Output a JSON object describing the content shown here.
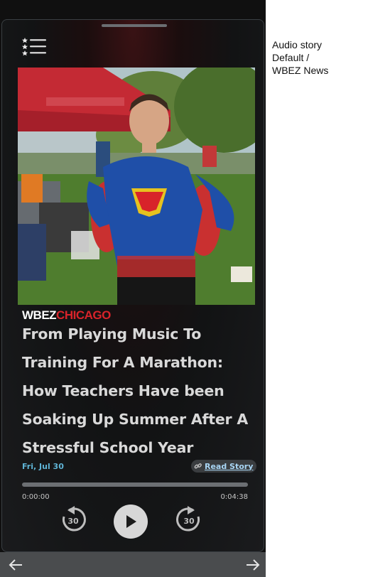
{
  "player": {
    "logo": {
      "wbez": "WBEZ",
      "chicago": "CHICAGO"
    },
    "headline": "From Playing Music To Training For A Marathon: How Teachers Have been Soaking Up Summer After A Stressful School Year",
    "date": "Fri, Jul 30",
    "read_story_label": "Read Story",
    "time_elapsed": "0:00:00",
    "time_total": "0:04:38",
    "progress_fraction": 0,
    "skip_seconds": "30",
    "icons": {
      "menu": "playlist-menu-icon",
      "link": "link-icon",
      "rewind": "rewind-30-icon",
      "play": "play-icon",
      "forward": "forward-30-icon",
      "prev": "arrow-left-icon",
      "next": "arrow-right-icon"
    }
  },
  "side_caption": {
    "line1": "Audio story",
    "line2": "Default /",
    "line3": "WBEZ News"
  },
  "colors": {
    "headline": "#d9d9d9",
    "date": "#5fb4d6",
    "read_story_link": "#a9d6f5",
    "logo_red": "#d8232a"
  }
}
